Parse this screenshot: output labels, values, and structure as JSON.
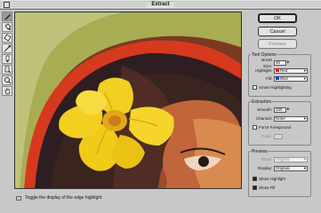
{
  "window": {
    "title": "Extract"
  },
  "toolbar": {
    "tools": [
      {
        "icon": "edge-highlighter-icon",
        "active": true
      },
      {
        "icon": "fill-icon",
        "active": false
      },
      {
        "icon": "eraser-icon",
        "active": false
      },
      {
        "icon": "eyedropper-icon",
        "active": false
      },
      {
        "icon": "cleanup-icon",
        "active": false
      },
      {
        "icon": "edge-touchup-icon",
        "active": false
      },
      {
        "icon": "zoom-icon",
        "active": false
      },
      {
        "icon": "hand-icon",
        "active": false
      }
    ]
  },
  "buttons": {
    "ok": "OK",
    "cancel": "Cancel",
    "preview": "Preview"
  },
  "tool_options": {
    "legend": "Tool Options",
    "brush_size_label": "Brush Size:",
    "brush_size_value": "40",
    "highlight_label": "Highlight:",
    "highlight_value": "Red",
    "highlight_color": "#e22020",
    "fill_label": "Fill:",
    "fill_value": "Blue",
    "fill_color": "#2040c0",
    "smart_highlighting_label": "Smart Highlighting"
  },
  "extraction": {
    "legend": "Extraction",
    "smooth_label": "Smooth:",
    "smooth_value": "100",
    "channel_label": "Channel:",
    "channel_value": "None",
    "force_foreground_label": "Force Foreground",
    "color_label": "Color:"
  },
  "preview": {
    "legend": "Preview",
    "show_label": "Show:",
    "show_value": "Original",
    "display_label": "Display:",
    "display_value": "Original",
    "show_highlight_label": "Show Highlight",
    "show_fill_label": "Show Fill"
  },
  "status": {
    "text": "Toggle the display of the edge highlight"
  }
}
